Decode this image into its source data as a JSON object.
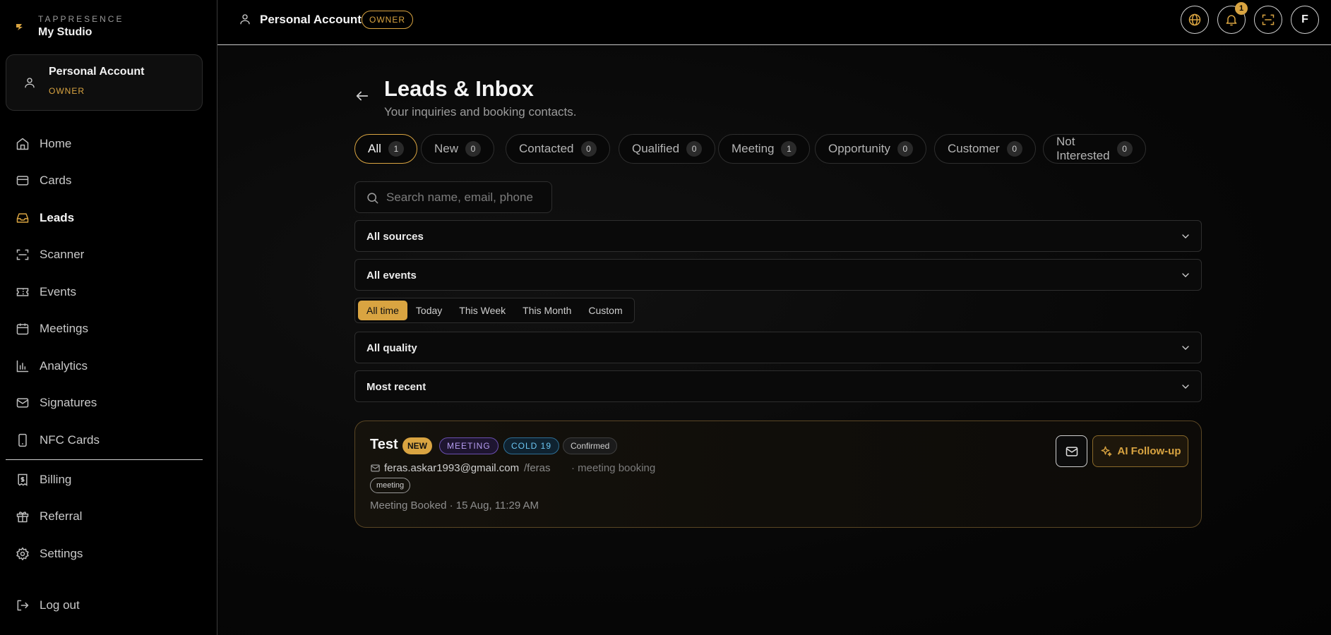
{
  "brand": {
    "top": "TAPPRESENCE",
    "name": "My Studio"
  },
  "account": {
    "name": "Personal Account",
    "role": "OWNER"
  },
  "nav": {
    "items": [
      {
        "label": "Home",
        "icon": "home-icon"
      },
      {
        "label": "Cards",
        "icon": "card-icon"
      },
      {
        "label": "Leads",
        "icon": "inbox-icon"
      },
      {
        "label": "Scanner",
        "icon": "scan-icon"
      },
      {
        "label": "Events",
        "icon": "ticket-icon"
      },
      {
        "label": "Meetings",
        "icon": "calendar-icon"
      },
      {
        "label": "Analytics",
        "icon": "bar-chart-icon"
      },
      {
        "label": "Signatures",
        "icon": "mail-icon"
      },
      {
        "label": "NFC Cards",
        "icon": "phone-icon"
      },
      {
        "label": "Billing",
        "icon": "receipt-icon"
      },
      {
        "label": "Referral",
        "icon": "gift-icon"
      },
      {
        "label": "Settings",
        "icon": "gear-icon"
      }
    ],
    "logout": "Log out"
  },
  "topbar": {
    "title": "Personal Account",
    "role": "OWNER",
    "notification_count": "1",
    "avatar_initial": "F"
  },
  "page": {
    "title": "Leads & Inbox",
    "subtitle": "Your inquiries and booking contacts."
  },
  "tabs": [
    {
      "label": "All",
      "count": "1"
    },
    {
      "label": "New",
      "count": "0"
    },
    {
      "label": "Contacted",
      "count": "0"
    },
    {
      "label": "Qualified",
      "count": "0"
    },
    {
      "label": "Meeting",
      "count": "1"
    },
    {
      "label": "Opportunity",
      "count": "0"
    },
    {
      "label": "Customer",
      "count": "0"
    },
    {
      "label": "Not Interested",
      "count": "0"
    }
  ],
  "search": {
    "placeholder": "Search name, email, phone",
    "value": ""
  },
  "filters": {
    "sources": "All sources",
    "events": "All events",
    "quality": "All quality",
    "sort": "Most recent"
  },
  "time_range": {
    "options": [
      "All time",
      "Today",
      "This Week",
      "This Month",
      "Custom"
    ],
    "selected": "All time"
  },
  "lead": {
    "name": "Test",
    "badges": {
      "new": "NEW",
      "meeting": "MEETING",
      "cold": "COLD 19",
      "status": "Confirmed"
    },
    "email": "feras.askar1993@gmail.com",
    "slug": "/feras",
    "source": "· meeting booking",
    "tag": "meeting",
    "activity": "Meeting Booked · 15 Aug, 11:29 AM",
    "ai_button": "AI Follow-up"
  },
  "colors": {
    "accent": "#d9a441",
    "background": "#000000",
    "meeting": "#b59cf0",
    "cold": "#6cc6f2"
  }
}
